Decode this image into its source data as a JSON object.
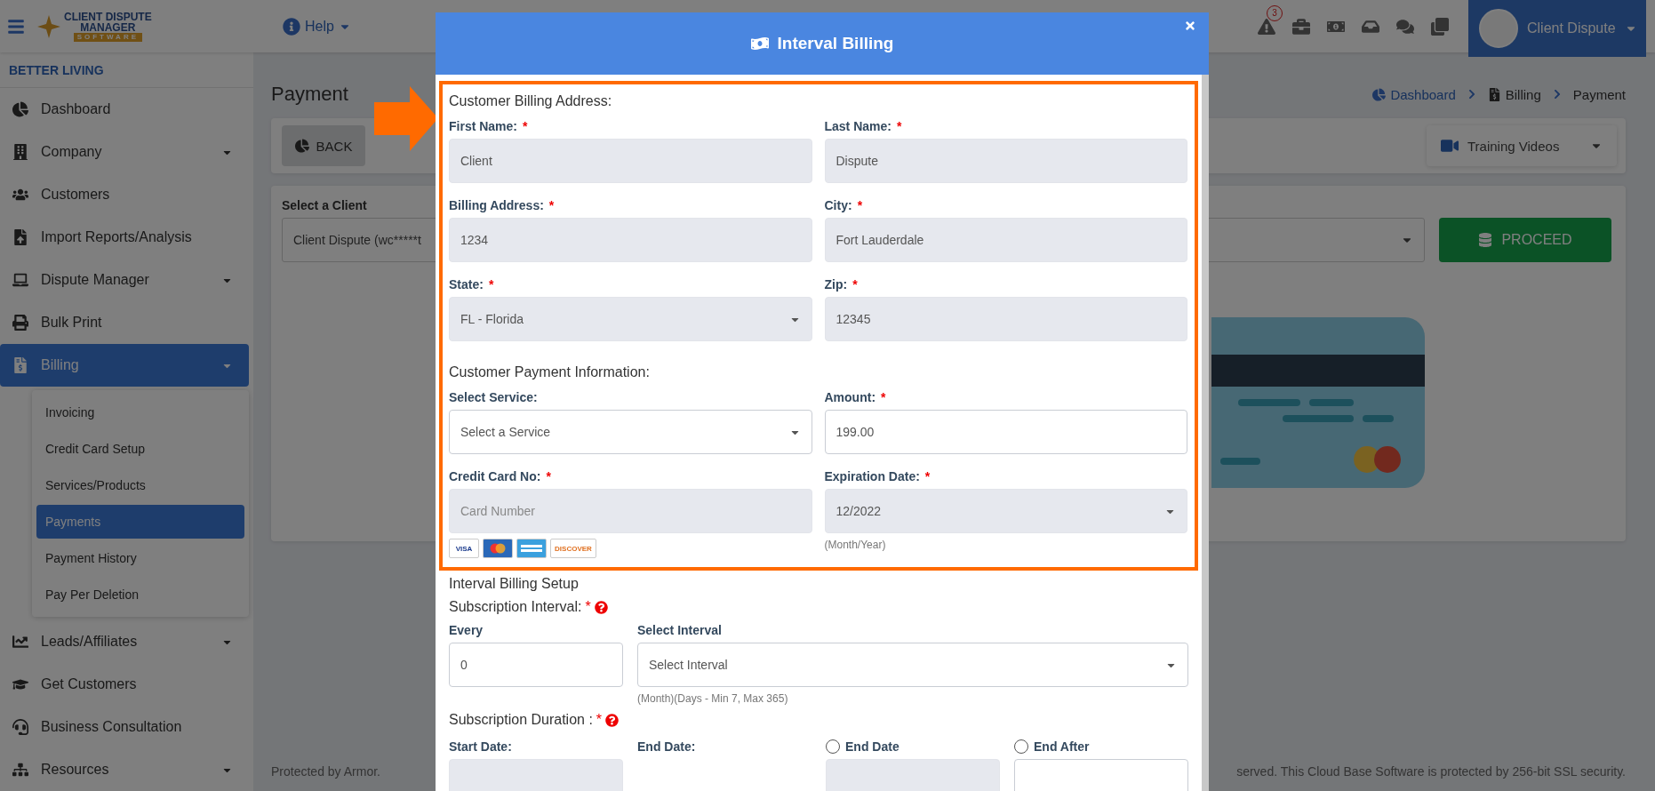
{
  "header": {
    "logo": [
      "CLIENT DISPUTE",
      "MANAGER",
      "SOFTWARE"
    ],
    "help": "Help",
    "toolbar": [
      {
        "kind": "warning",
        "badge": "3"
      },
      {
        "kind": "briefcase"
      },
      {
        "kind": "money"
      },
      {
        "kind": "inbox"
      },
      {
        "kind": "chat"
      },
      {
        "kind": "copy"
      }
    ],
    "user": "Client Dispute"
  },
  "sidebar": {
    "account": "BETTER LIVING",
    "items": [
      {
        "label": "Dashboard",
        "caret": false,
        "selected": false
      },
      {
        "label": "Company",
        "caret": true,
        "selected": false
      },
      {
        "label": "Customers",
        "caret": false,
        "selected": false
      },
      {
        "label": "Import Reports/Analysis",
        "caret": false,
        "selected": false
      },
      {
        "label": "Dispute Manager",
        "caret": true,
        "selected": false
      },
      {
        "label": "Bulk Print",
        "caret": false,
        "selected": false
      },
      {
        "label": "Billing",
        "caret": true,
        "selected": true,
        "children": [
          {
            "label": "Invoicing",
            "selected": false
          },
          {
            "label": "Credit Card Setup",
            "selected": false
          },
          {
            "label": "Services/Products",
            "selected": false
          },
          {
            "label": "Payments",
            "selected": true
          },
          {
            "label": "Payment History",
            "selected": false
          },
          {
            "label": "Pay Per Deletion",
            "selected": false
          }
        ]
      },
      {
        "label": "Leads/Affiliates",
        "caret": true,
        "selected": false
      },
      {
        "label": "Get Customers",
        "caret": false,
        "selected": false
      },
      {
        "label": "Business Consultation",
        "caret": false,
        "selected": false
      },
      {
        "label": "Resources",
        "caret": true,
        "selected": false
      }
    ]
  },
  "page": {
    "title": "Payment",
    "breadcrumb": [
      {
        "label": "Dashboard",
        "kind": "link"
      },
      {
        "label": "Billing",
        "kind": "file"
      },
      {
        "label": "Payment",
        "kind": "current"
      }
    ],
    "back": "BACK",
    "training": "Training Videos",
    "client_label": "Select a Client",
    "client_value": "Client Dispute (wc*****t",
    "proceed": "PROCEED"
  },
  "footer": {
    "left": "Protected by Armor.",
    "right": "served. This Cloud Base Software is protected by 256-bit SSL security."
  },
  "modal": {
    "title": "Interval Billing",
    "billing_address": {
      "heading": "Customer Billing Address:",
      "fields": [
        {
          "label": "First Name:",
          "required_mark": "*",
          "kind": "input",
          "value": "Client",
          "disabled": true
        },
        {
          "label": "Last Name:",
          "required_mark": "*",
          "kind": "input",
          "value": "Dispute",
          "disabled": true
        },
        {
          "label": "Billing Address:",
          "required_mark": "*",
          "kind": "input",
          "value": "1234",
          "disabled": true
        },
        {
          "label": "City:",
          "required_mark": "*",
          "kind": "input",
          "value": "Fort Lauderdale",
          "disabled": true
        },
        {
          "label": "State:",
          "required_mark": "*",
          "kind": "select",
          "value": "FL - Florida",
          "disabled": true
        },
        {
          "label": "Zip:",
          "required_mark": "*",
          "kind": "input",
          "value": "12345",
          "disabled": true
        }
      ]
    },
    "payment": {
      "heading": "Customer Payment Information:",
      "fields": [
        {
          "label": "Select Service:",
          "kind": "select",
          "value": "Select a Service",
          "disabled": false
        },
        {
          "label": "Amount:",
          "required_mark": "*",
          "kind": "input",
          "value": "199.00",
          "disabled": false
        },
        {
          "label": "Credit Card No:",
          "required_mark": "*",
          "kind": "input",
          "placeholder": "Card Number",
          "disabled": true,
          "card_logos": [
            {
              "kind": "visa",
              "label": "VISA"
            },
            {
              "kind": "mastercard"
            },
            {
              "kind": "amex"
            },
            {
              "kind": "discover",
              "label": "DISCOVER"
            }
          ]
        },
        {
          "label": "Expiration Date:",
          "required_mark": "*",
          "kind": "select",
          "value": "12/2022",
          "disabled": true,
          "hint": "(Month/Year)"
        }
      ]
    },
    "interval": {
      "heading": "Interval Billing Setup",
      "label": "Subscription Interval:",
      "required_mark": "*",
      "every_label": "Every",
      "every_value": "0",
      "select_label": "Select Interval",
      "select_value": "Select Interval",
      "hint": "(Month)(Days - Min 7, Max 365)"
    },
    "duration": {
      "label": "Subscription Duration :",
      "required_mark": "*",
      "columns": [
        {
          "kind": "field",
          "label": "Start Date:",
          "disabled": true
        },
        {
          "kind": "caption",
          "label": "End Date:"
        },
        {
          "kind": "radio",
          "label": "End Date",
          "checked": false,
          "disabled": true
        },
        {
          "kind": "radio",
          "label": "End After",
          "checked": false,
          "disabled": false
        }
      ]
    }
  }
}
